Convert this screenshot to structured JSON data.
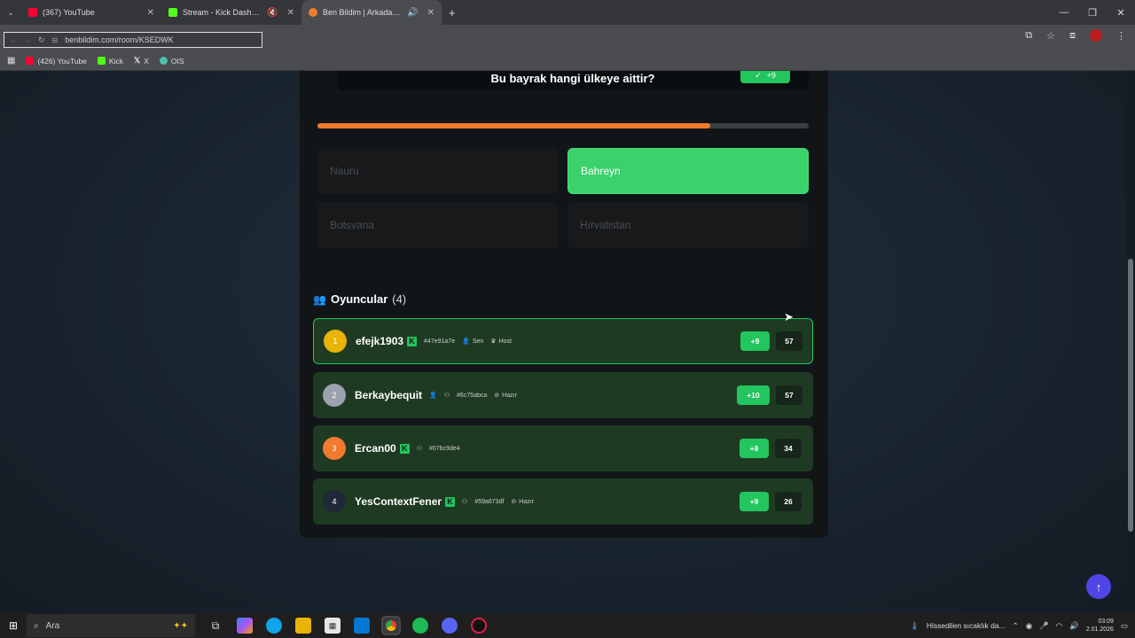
{
  "browser": {
    "tabs": [
      {
        "title": "(367) YouTube",
        "favicon_color": "#ff0033"
      },
      {
        "title": "Stream - Kick Dashboard",
        "favicon_color": "#53fc18"
      },
      {
        "title": "Ben Bildim | Arkadaşlarınla",
        "favicon_color": "#f07a2e"
      }
    ],
    "new_tab": "+",
    "url": "benbildim.com/room/KSEDWK",
    "bookmarks": [
      {
        "label": "(426) YouTube",
        "color": "#ff0033"
      },
      {
        "label": "Kick",
        "color": "#53fc18"
      },
      {
        "label": "X",
        "color": "#ffffff"
      },
      {
        "label": "OIS",
        "color": "#4ec0b0"
      }
    ]
  },
  "question": {
    "text": "Bu bayrak hangi ülkeye aittir?",
    "badge": "+9",
    "progress": 0.8
  },
  "answers": [
    {
      "label": "Nauru",
      "correct": false
    },
    {
      "label": "Bahreyn",
      "correct": true
    },
    {
      "label": "Botsvana",
      "correct": false
    },
    {
      "label": "Hırvatistan",
      "correct": false
    }
  ],
  "players_section": {
    "title": "Oyuncular",
    "count": "(4)"
  },
  "players": [
    {
      "rank": "1",
      "name": "efejk1903",
      "rank_color": "#eab308",
      "kick": true,
      "id": "#47e91a7e",
      "tags": [
        "Sen",
        "Host"
      ],
      "points": "+9",
      "score": "57"
    },
    {
      "rank": "2",
      "name": "Berkaybequit",
      "rank_color": "#9ca3af",
      "kick": false,
      "id": "#6c75abca",
      "tags": [
        "Hazır"
      ],
      "points": "+10",
      "score": "57"
    },
    {
      "rank": "3",
      "name": "Ercan00",
      "rank_color": "#f07a2e",
      "kick": true,
      "id": "#07bc9de4",
      "tags": [],
      "points": "+8",
      "score": "34"
    },
    {
      "rank": "4",
      "name": "YesContextFener",
      "rank_color": "#1f2937",
      "kick": true,
      "id": "#59a673df",
      "tags": [
        "Hazır"
      ],
      "points": "+9",
      "score": "26"
    }
  ],
  "taskbar": {
    "search_placeholder": "Ara",
    "weather": "Hissedilen sıcaklık da...",
    "time": "03:09",
    "date": "2.01.2026"
  }
}
